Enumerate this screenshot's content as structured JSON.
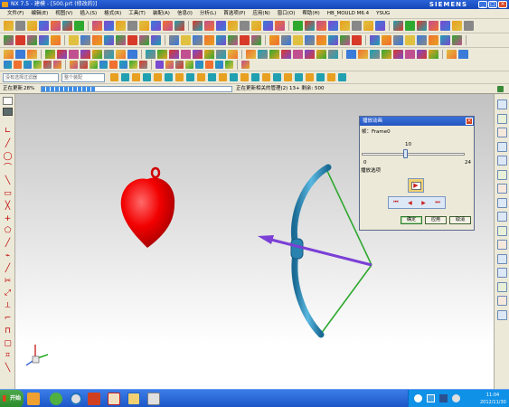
{
  "window": {
    "title": "NX 7.5 - 建模 - [500.prt (修改的)]",
    "brand": "SIEMENS",
    "minimize": "_",
    "maximize": "□",
    "close": "×"
  },
  "menu": {
    "items": [
      "文件(F)",
      "编辑(E)",
      "视图(V)",
      "插入(S)",
      "格式(R)",
      "工具(T)",
      "装配(A)",
      "信息(I)",
      "分析(L)",
      "首选项(P)",
      "应用(N)",
      "窗口(O)",
      "帮助(H)",
      "HB_MOULD M6.4",
      "YSUG"
    ]
  },
  "selection_bar": {
    "filter_placeholder": "没有选择过滤器",
    "scope_placeholder": "整个装配"
  },
  "status": {
    "progress_label": "正在更新",
    "progress_value": "28%",
    "progress_fraction": 0.28,
    "message": "正在更新相关的管理(2) 13+ 剩余: 500"
  },
  "dialog": {
    "title": "播放动画",
    "frame_label": "帧：Frame0",
    "slider_value": "10",
    "slider_min": "0",
    "slider_max": "24",
    "slider_fraction": 0.417,
    "playback_label": "播放选项",
    "play_icon": "▶",
    "transport": [
      "⏮",
      "◀",
      "▶",
      "⏭"
    ],
    "ok": "确定",
    "apply": "应用",
    "cancel": "取消",
    "close": "×"
  },
  "taskbar": {
    "start": "开始",
    "time": "11:04",
    "date": "2012/11/30"
  },
  "colors": {
    "heart": "#ff0000",
    "bow": "#2f8fc0",
    "string": "#2fa82f",
    "arrow": "#7b3fd6"
  }
}
